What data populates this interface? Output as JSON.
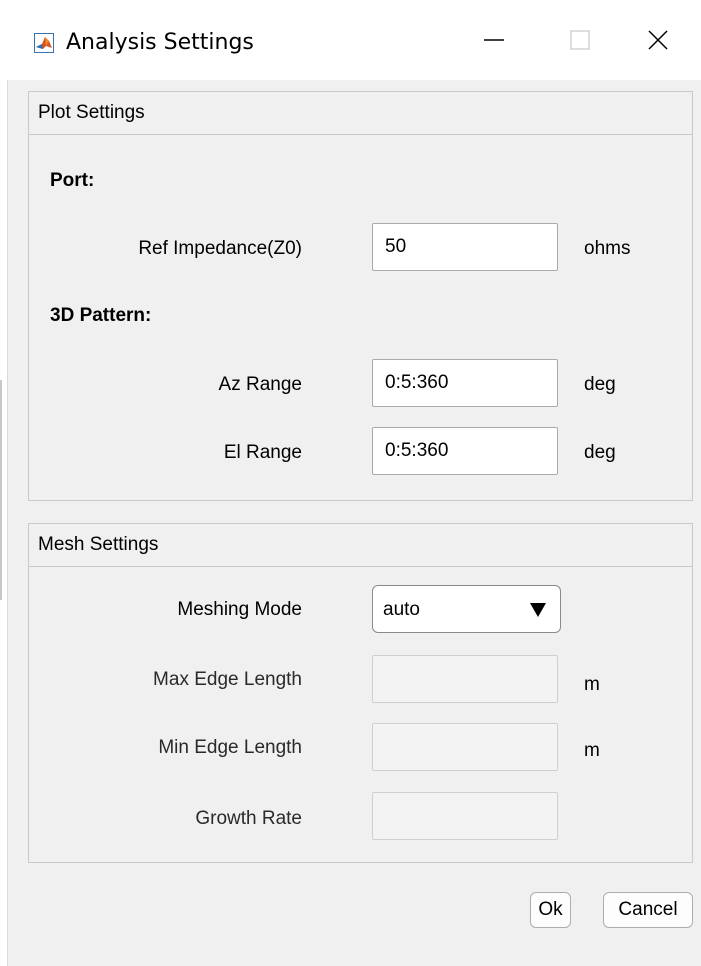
{
  "window": {
    "title": "Analysis Settings",
    "app_icon": "matlab-icon"
  },
  "plot_settings": {
    "title": "Plot Settings",
    "port_label": "Port:",
    "ref_impedance": {
      "label": "Ref Impedance(Z0)",
      "value": "50",
      "unit": "ohms"
    },
    "pattern_label": "3D Pattern:",
    "az_range": {
      "label": "Az Range",
      "value": "0:5:360",
      "unit": "deg"
    },
    "el_range": {
      "label": "El Range",
      "value": "0:5:360",
      "unit": "deg"
    }
  },
  "mesh_settings": {
    "title": "Mesh Settings",
    "meshing_mode": {
      "label": "Meshing Mode",
      "value": "auto"
    },
    "max_edge_length": {
      "label": "Max Edge Length",
      "value": "",
      "unit": "m"
    },
    "min_edge_length": {
      "label": "Min Edge Length",
      "value": "",
      "unit": "m"
    },
    "growth_rate": {
      "label": "Growth Rate",
      "value": ""
    }
  },
  "buttons": {
    "ok": "Ok",
    "cancel": "Cancel"
  },
  "colors": {
    "window_bg": "#f0f0f0",
    "titlebar_bg": "#ffffff",
    "panel_border": "#c9c9c9"
  }
}
